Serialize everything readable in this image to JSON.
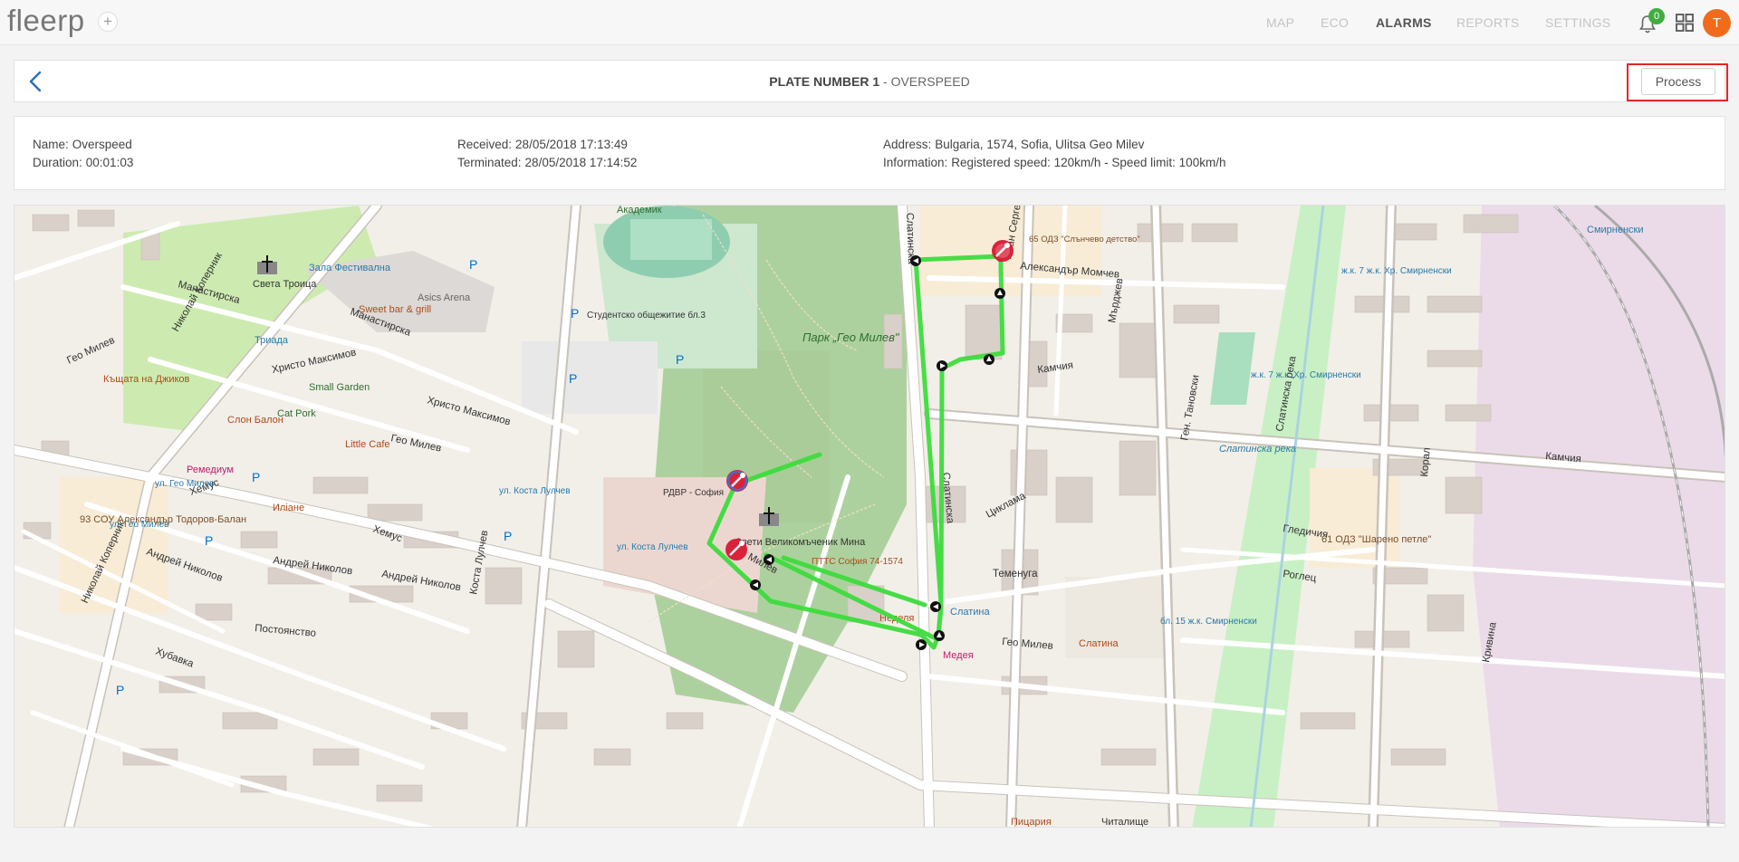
{
  "app": {
    "logo": "fleerp",
    "add_label": "+"
  },
  "nav": {
    "items": [
      {
        "label": "MAP"
      },
      {
        "label": "ECO"
      },
      {
        "label": "ALARMS",
        "active": true
      },
      {
        "label": "REPORTS"
      },
      {
        "label": "SETTINGS"
      }
    ],
    "notifications_count": "0",
    "avatar_initial": "T"
  },
  "header": {
    "plate": "PLATE NUMBER 1",
    "separator": " - ",
    "alarm_type": "OVERSPEED",
    "process_label": "Process"
  },
  "details": {
    "name_label": "Name:",
    "name_value": "Overspeed",
    "duration_label": "Duration:",
    "duration_value": "00:01:03",
    "received_label": "Received:",
    "received_value": "28/05/2018 17:13:49",
    "terminated_label": "Terminated:",
    "terminated_value": "28/05/2018 17:14:52",
    "address_label": "Address:",
    "address_value": "Bulgaria, 1574, Sofia, Ulitsa Geo Milev",
    "information_label": "Information:",
    "information_value": "Registered speed: 120km/h - Speed limit: 100km/h"
  },
  "map": {
    "route_color": "#3ddc3d",
    "labels": {
      "park": "Парк „Гео Милев\"",
      "arena": "Asics Arena",
      "akademik": "Академик",
      "geo_milev_1": "Гео Милев",
      "geo_milev_2": "Гео Милев",
      "geo_milev_3": "Гео Милев",
      "geo_milev_4": "Гео Милев",
      "slatinska": "Слатинска",
      "slatinska_2": "Слатинска",
      "kamchia": "Камчия",
      "kamchia_2": "Камчия",
      "aleksandar_momchev": "Александър Момчев",
      "hristo_maksimov": "Христо Максимов",
      "hristo_maksimov_2": "Христо Максимов",
      "manastirska": "Манастирска",
      "manastirska_2": "Манастирска",
      "nikolay_kopernik": "Николай Коперник",
      "hemus": "Хемус",
      "hemus_2": "Хемус",
      "andrey_nikolov": "Андрей Николов",
      "andrey_nikolov_2": "Андрей Николов",
      "andrey_nikolov_3": "Андрей Николов",
      "postoyanstvo": "Постоянство",
      "hubavka": "Хубавка",
      "tsiklama": "Циклама",
      "temenuga": "Теменуга",
      "roglets": "Роглец",
      "gledichia": "Гледичия",
      "koral": "Корал",
      "krivina": "Кривина",
      "muldrets": "Мърджев",
      "ivan_sergeev": "Иван Сергеев",
      "slatinska_reka": "Слатинска река",
      "slatinska_reka_2": "Слатинска река",
      "gen_tanevski": "Ген. Тановски",
      "kosta_lulchev": "Коста Лулчев",
      "smirnenski": "Смирненски",
      "sou_93": "93 СОУ Александър Тодоров-Балан",
      "odz_61": "61 ОДЗ \"Шарено петле\"",
      "odz_65": "65 ОДЗ \"Слънчево детство\"",
      "sveta_troitsa": "Света Троица",
      "sveti_mina": "Свети Великомъченик Мина",
      "rdvr": "РДВР - София",
      "ptts": "ПТТС София 74-1574",
      "slatina": "Слатина",
      "sweet_bar": "Sweet bar & grill",
      "zala_festivalna": "Зала Фестивална",
      "studentsko": "Студентско общежитие бл.3",
      "small_garden": "Small Garden",
      "cat_pork": "Cat Pork",
      "little_cafe": "Little Cafe",
      "slon_balon": "Слон Балон",
      "kashtata": "Къщата на Джиков",
      "remedium": "Ремедиум",
      "iliane": "Иліане",
      "triada": "Триада",
      "nedelya": "Неделя",
      "medea": "Медея",
      "pitsaria": "Пицария",
      "chitalishte": "Читалище",
      "stop_slatina": "Слатина",
      "stop_kosta_lulchev": "ул. Коста Лулчев",
      "stop_kosta_lulchev_2": "ул. Коста Лулчев",
      "stop_geo_milev": "ул. Гео Милев",
      "stop_geo_milev_2": "ул. Гео Милев",
      "stop_zk7": "ж.к. 7 ж.к. Хр. Смирненски",
      "stop_zk7_2": "ж.к. 7 ж.к. Хр. Смирненски",
      "stop_zk15": "бл. 15 ж.к. Смирненски",
      "parking": "P"
    }
  }
}
